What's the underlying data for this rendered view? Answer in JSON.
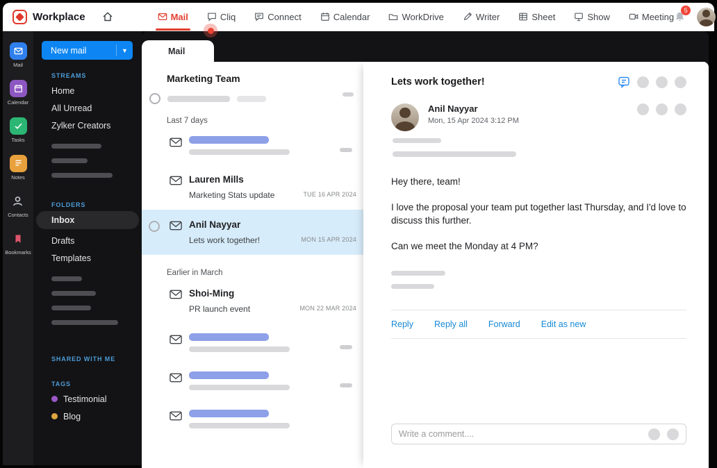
{
  "topbar": {
    "brand": "Workplace",
    "nav": [
      {
        "label": "Mail"
      },
      {
        "label": "Cliq"
      },
      {
        "label": "Connect"
      },
      {
        "label": "Calendar"
      },
      {
        "label": "WorkDrive"
      },
      {
        "label": "Writer"
      },
      {
        "label": "Sheet"
      },
      {
        "label": "Show"
      },
      {
        "label": "Meeting"
      }
    ],
    "notification_count": "5"
  },
  "rail": {
    "items": [
      {
        "label": "Mail"
      },
      {
        "label": "Calendar"
      },
      {
        "label": "Tasks"
      },
      {
        "label": "Notes"
      },
      {
        "label": "Contacts"
      },
      {
        "label": "Bookmarks"
      }
    ]
  },
  "sidebar": {
    "new_mail_label": "New mail",
    "sections": {
      "streams": "STREAMS",
      "folders": "FOLDERS",
      "shared": "SHARED WITH ME",
      "tags": "TAGS"
    },
    "streams_items": [
      {
        "label": "Home"
      },
      {
        "label": "All Unread"
      },
      {
        "label": "Zylker Creators"
      }
    ],
    "folders_items": [
      {
        "label": "Inbox"
      },
      {
        "label": "Drafts"
      },
      {
        "label": "Templates"
      }
    ],
    "tags_items": [
      {
        "label": "Testimonial",
        "color": "#9b59c8"
      },
      {
        "label": "Blog",
        "color": "#dca73f"
      }
    ]
  },
  "list": {
    "tab": "Mail",
    "group_title": "Marketing Team",
    "section_recent": "Last 7 days",
    "section_older": "Earlier in March",
    "emails": [
      {
        "sender": "Lauren Mills",
        "subject": "Marketing Stats update",
        "date": "TUE 16 APR 2024"
      },
      {
        "sender": "Anil Nayyar",
        "subject": "Lets work together!",
        "date": "MON 15 APR 2024",
        "selected": true
      },
      {
        "sender": "Shoi-Ming",
        "subject": "PR launch event",
        "date": "MON 22 MAR 2024"
      }
    ]
  },
  "reader": {
    "subject": "Lets work together!",
    "sender": "Anil Nayyar",
    "timestamp": "Mon, 15 Apr 2024 3:12 PM",
    "body": [
      "Hey there, team!",
      "I love the proposal your team put together last Thursday, and I'd love to discuss this further.",
      "Can we meet the Monday at 4 PM?"
    ],
    "actions": [
      {
        "label": "Reply"
      },
      {
        "label": "Reply all"
      },
      {
        "label": "Forward"
      },
      {
        "label": "Edit as new"
      }
    ],
    "comment_placeholder": "Write a comment...."
  },
  "colors": {
    "accent_red": "#e23f30",
    "primary_blue": "#0d86f3",
    "link_blue": "#1689d6",
    "selection_blue": "#d7ecfa",
    "skeleton_blue": "#8da0e8"
  }
}
